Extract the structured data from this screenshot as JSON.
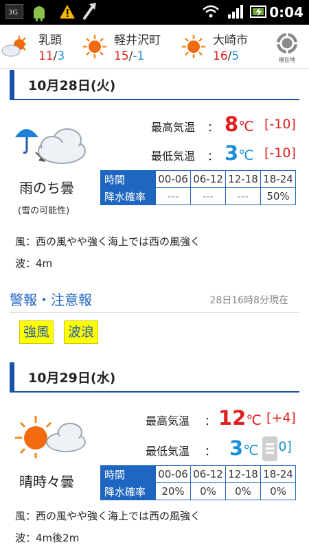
{
  "status_bar": {
    "time": "0:04",
    "network": "3G"
  },
  "cities": [
    {
      "name": "乳頭",
      "high": "11",
      "low": "3",
      "icon": "sun-cloud-icon"
    },
    {
      "name": "軽井沢町",
      "high": "15",
      "low": "-1",
      "icon": "sun-icon"
    },
    {
      "name": "大崎市",
      "high": "16",
      "low": "5",
      "icon": "sun-icon"
    }
  ],
  "location_button": {
    "label": "現在地"
  },
  "days": [
    {
      "date": "10月28日(火)",
      "weather_label": "雨のち曇",
      "weather_sub": "(雪の可能性)",
      "icon": "umbrella-cloud-icon",
      "high_label": "最高気温",
      "high_value": "8",
      "high_diff": "[-10]",
      "low_label": "最低気温",
      "low_value": "3",
      "low_diff": "[-10]",
      "unit": "℃",
      "colon": "：",
      "pop_header": {
        "time": "時間",
        "rain": "降水確率"
      },
      "pop_times": [
        "00-06",
        "06-12",
        "12-18",
        "18-24"
      ],
      "pop_values": [
        "---",
        "---",
        "---",
        "50%"
      ],
      "wind": "風：西の風やや強く海上では西の風強く",
      "wave": "波：4m"
    },
    {
      "date": "10月29日(水)",
      "weather_label": "晴時々曇",
      "icon": "sun-cloud-icon",
      "high_label": "最高気温",
      "high_value": "12",
      "high_diff": "[+4]",
      "low_label": "最低気温",
      "low_value": "3",
      "low_diff": "[0]",
      "unit": "℃",
      "colon": "：",
      "pop_header": {
        "time": "時間",
        "rain": "降水確率"
      },
      "pop_times": [
        "00-06",
        "06-12",
        "12-18",
        "18-24"
      ],
      "pop_values": [
        "20%",
        "0%",
        "0%",
        "0%"
      ],
      "wind": "風：西の風やや強く海上では西の風強く",
      "wave": "波：4m後2m"
    }
  ],
  "warnings": {
    "title": "警報・注意報",
    "timestamp": "28日16時8分現在",
    "items": [
      "強風",
      "波浪"
    ]
  },
  "colors": {
    "accent": "#1f66c1",
    "high": "#e0201e",
    "low": "#1b8fd8",
    "warning_bg": "#ffff00"
  }
}
